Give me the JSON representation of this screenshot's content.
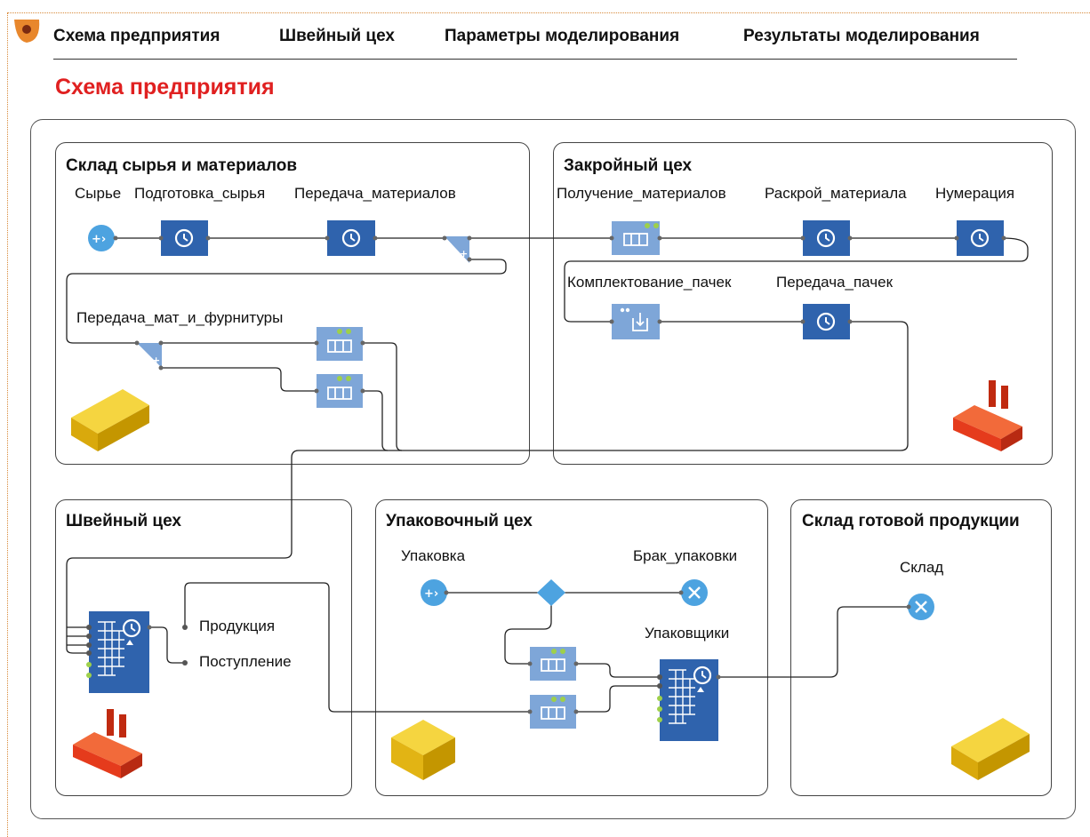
{
  "tabs": [
    {
      "label": "Схема предприятия"
    },
    {
      "label": "Швейный цех"
    },
    {
      "label": "Параметры моделирования"
    },
    {
      "label": "Результаты моделирования"
    }
  ],
  "page_title": "Схема предприятия",
  "sections": {
    "warehouse_raw": {
      "title": "Склад сырья и материалов"
    },
    "cutting": {
      "title": "Закройный цех"
    },
    "sewing": {
      "title": "Швейный цех"
    },
    "packing": {
      "title": "Упаковочный цех"
    },
    "warehouse_finished": {
      "title": "Склад готовой продукции"
    }
  },
  "blocks": {
    "source_raw": "Сырье",
    "prep_raw": "Подготовка_сырья",
    "transfer_materials": "Передача_материалов",
    "transfer_mat_fittings": "Передача_мат_и_фурнитуры",
    "receive_materials": "Получение_материалов",
    "cut_material": "Раскрой_материала",
    "numbering": "Нумерация",
    "bundle_assembly": "Комплектование_пачек",
    "transfer_bundles": "Передача_пачек",
    "product_port": "Продукция",
    "supply_port": "Поступление",
    "packing_source": "Упаковка",
    "packing_defect": "Брак_упаковки",
    "packers": "Упаковщики",
    "storage": "Склад"
  },
  "colors": {
    "accent_red": "#e02020",
    "block_dark": "#2f63ad",
    "block_light": "#7ea6d8",
    "circle_blue": "#4da3e0",
    "led_green": "#9ed04a",
    "warehouse_yellow": "#f2cb1a",
    "factory_red": "#e53b1c"
  }
}
